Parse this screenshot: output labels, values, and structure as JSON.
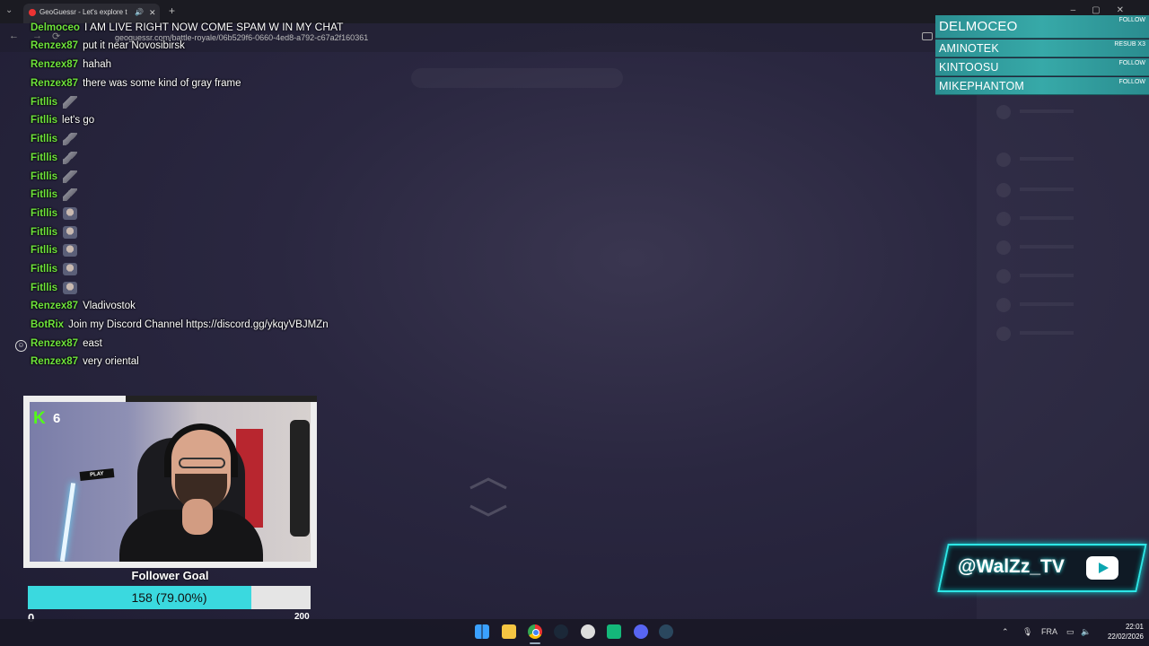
{
  "browser": {
    "tab_title": "GeoGuessr - Let's explore t",
    "url": "geoguessr.com/battle-royale/06b529f6-0660-4ed8-a792-c67a2f160361"
  },
  "chat": [
    {
      "user": "Delmoceo",
      "message": "I AM LIVE RIGHT NOW COME SPAM W IN MY CHAT"
    },
    {
      "user": "Renzex87",
      "message": "put it near Novosibirsk"
    },
    {
      "user": "Renzex87",
      "message": "hahah"
    },
    {
      "user": "Renzex87",
      "message": "there was some kind of gray frame"
    },
    {
      "user": "Fitllis",
      "message": "",
      "emote": "bird"
    },
    {
      "user": "Fitllis",
      "message": "let's go"
    },
    {
      "user": "Fitllis",
      "message": "",
      "emote": "bird"
    },
    {
      "user": "Fitllis",
      "message": "",
      "emote": "bird"
    },
    {
      "user": "Fitllis",
      "message": "",
      "emote": "bird"
    },
    {
      "user": "Fitllis",
      "message": "",
      "emote": "bird"
    },
    {
      "user": "Fitllis",
      "message": "",
      "emote": "face"
    },
    {
      "user": "Fitllis",
      "message": "",
      "emote": "face"
    },
    {
      "user": "Fitllis",
      "message": "",
      "emote": "face"
    },
    {
      "user": "Fitllis",
      "message": "",
      "emote": "face"
    },
    {
      "user": "Fitllis",
      "message": "",
      "emote": "face"
    },
    {
      "user": "Renzex87",
      "message": "Vladivostok"
    },
    {
      "user": "BotRix",
      "message": "Join my Discord Channel https://discord.gg/ykqyVBJMZn"
    },
    {
      "user": "Renzex87",
      "message": "east"
    },
    {
      "user": "Renzex87",
      "message": "very oriental"
    }
  ],
  "events": [
    {
      "name": "DELMOCEO",
      "tag": "FOLLOW"
    },
    {
      "name": "AMINOTEK",
      "tag": "RESUB X3"
    },
    {
      "name": "KINTOOSU",
      "tag": "FOLLOW"
    },
    {
      "name": "MIKEPHANTOM",
      "tag": "FOLLOW"
    }
  ],
  "webcam": {
    "kick_count": "6",
    "sign_text": "PLAY"
  },
  "follower_goal": {
    "title": "Follower Goal",
    "current": 158,
    "target": 200,
    "progress_text": "158 (79.00%)",
    "progress_fraction": 0.79,
    "min_label": "0",
    "max_label": "200"
  },
  "handle": {
    "text": "@WalZz_TV",
    "accent": "#2ee6e6"
  },
  "taskbar": {
    "language": "FRA",
    "time": "22:01",
    "date": "22/02/2026",
    "icons": [
      "windows-icon",
      "file-explorer-icon",
      "chrome-icon",
      "steam-icon",
      "obs-icon",
      "kick-icon",
      "discord-icon",
      "steam-icon"
    ]
  }
}
